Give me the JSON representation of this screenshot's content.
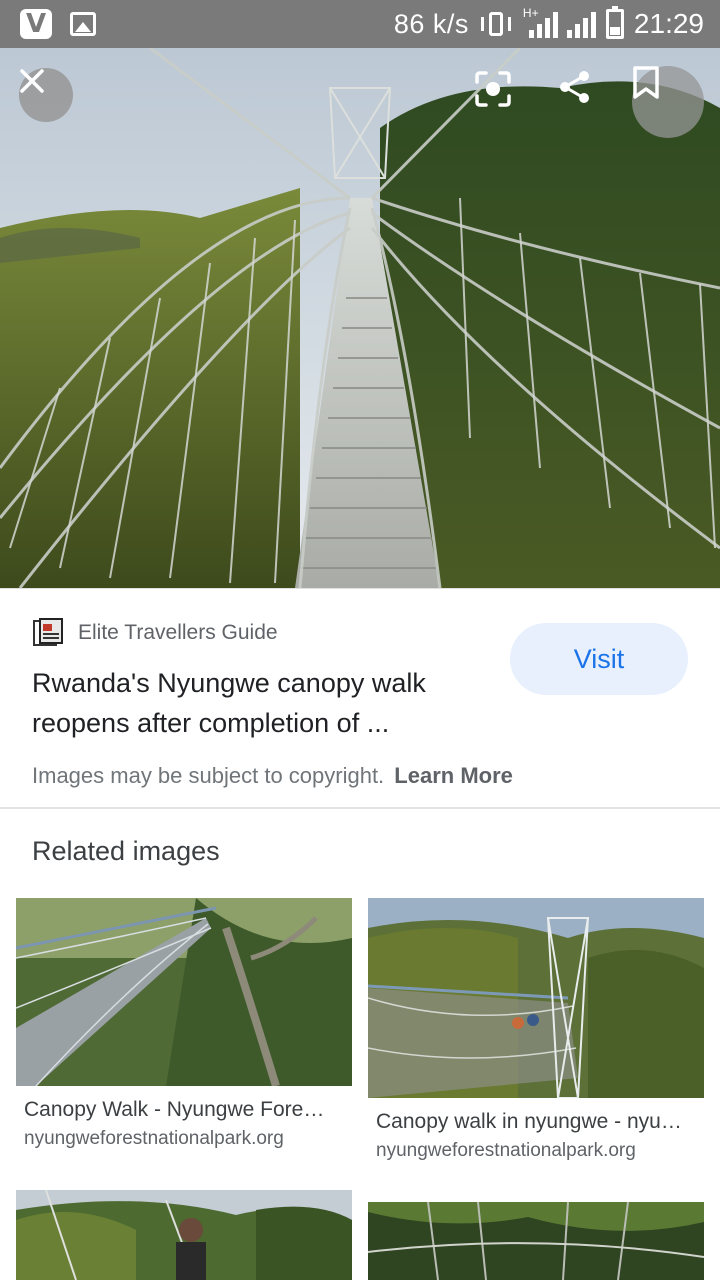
{
  "status_bar": {
    "speed": "86 k/s",
    "network_type": "H+",
    "time": "21:29",
    "app_icon_letter": "V"
  },
  "viewer": {
    "icons": {
      "close": "close-icon",
      "lens": "lens-icon",
      "share": "share-icon",
      "save": "bookmark-icon"
    }
  },
  "result": {
    "source_name": "Elite Travellers Guide",
    "title": "Rwanda's Nyungwe canopy walk reopens after completion of ...",
    "visit_label": "Visit",
    "copyright_text": "Images may be subject to copyright.",
    "learn_more_label": "Learn More"
  },
  "related": {
    "heading": "Related images",
    "items": [
      {
        "title": "Canopy Walk - Nyungwe Fore…",
        "domain": "nyungweforestnationalpark.org"
      },
      {
        "title": "Canopy walk in nyungwe - nyu…",
        "domain": "nyungweforestnationalpark.org"
      },
      {
        "title": "",
        "domain": ""
      },
      {
        "title": "",
        "domain": ""
      }
    ]
  },
  "colors": {
    "status_bar": "#7a7a7a",
    "visit_bg": "#e8f0fe",
    "visit_text": "#1a73e8"
  }
}
